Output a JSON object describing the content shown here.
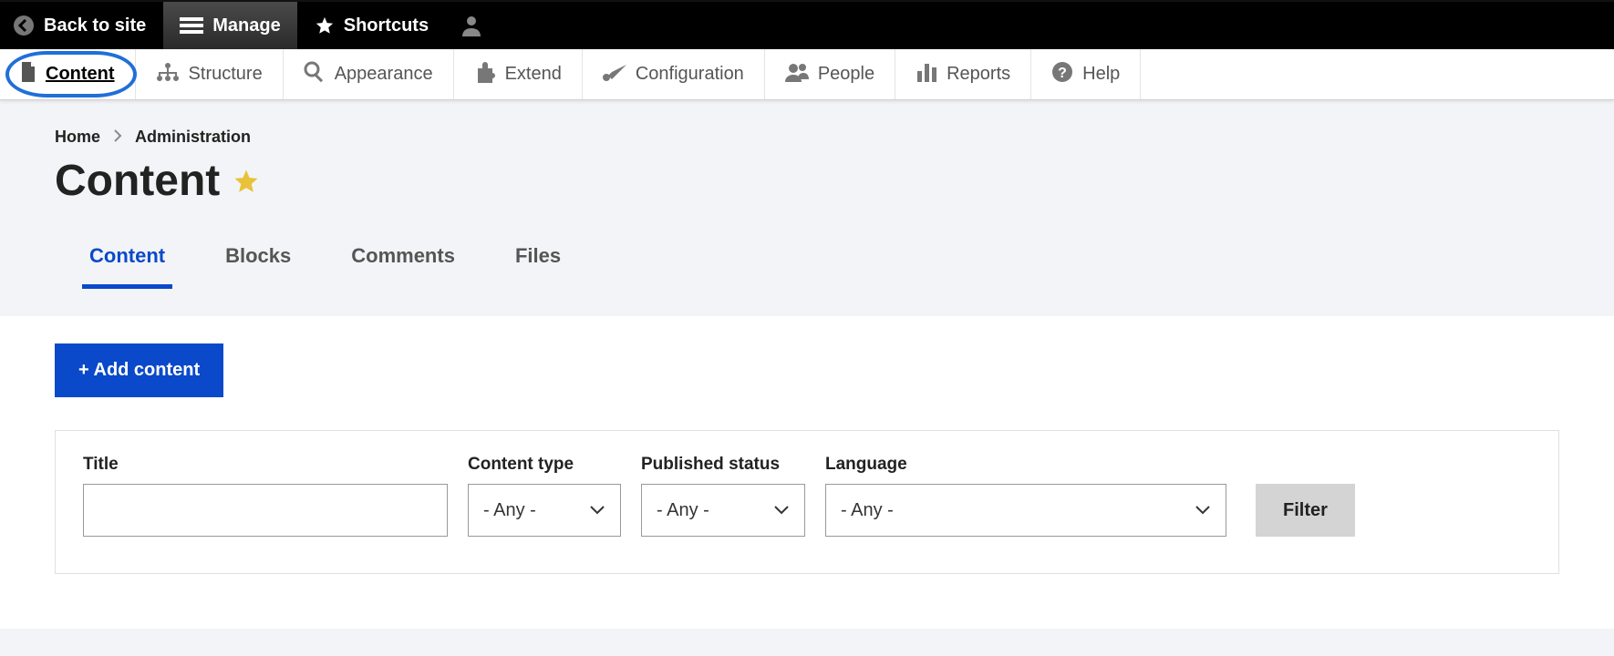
{
  "topbar": {
    "back_label": "Back to site",
    "manage_label": "Manage",
    "shortcuts_label": "Shortcuts",
    "user_label": ""
  },
  "adminmenu": {
    "items": [
      {
        "label": "Content",
        "icon": "content-icon",
        "active": true
      },
      {
        "label": "Structure",
        "icon": "structure-icon",
        "active": false
      },
      {
        "label": "Appearance",
        "icon": "appearance-icon",
        "active": false
      },
      {
        "label": "Extend",
        "icon": "extend-icon",
        "active": false
      },
      {
        "label": "Configuration",
        "icon": "configuration-icon",
        "active": false
      },
      {
        "label": "People",
        "icon": "people-icon",
        "active": false
      },
      {
        "label": "Reports",
        "icon": "reports-icon",
        "active": false
      },
      {
        "label": "Help",
        "icon": "help-icon",
        "active": false
      }
    ]
  },
  "breadcrumb": {
    "items": [
      "Home",
      "Administration"
    ]
  },
  "page_title": "Content",
  "subtabs": {
    "items": [
      "Content",
      "Blocks",
      "Comments",
      "Files"
    ],
    "active_index": 0
  },
  "actions": {
    "add_content_label": "+ Add content"
  },
  "filters": {
    "title_label": "Title",
    "title_value": "",
    "content_type_label": "Content type",
    "content_type_value": "- Any -",
    "published_status_label": "Published status",
    "published_status_value": "- Any -",
    "language_label": "Language",
    "language_value": "- Any -",
    "filter_button_label": "Filter"
  }
}
